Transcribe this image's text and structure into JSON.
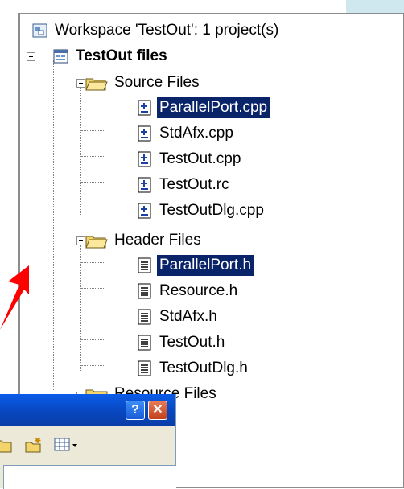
{
  "tree": {
    "workspace_label": "Workspace 'TestOut': 1 project(s)",
    "project_label": "TestOut files",
    "folders": [
      {
        "label": "Source Files",
        "items": [
          "ParallelPort.cpp",
          "StdAfx.cpp",
          "TestOut.cpp",
          "TestOut.rc",
          "TestOutDlg.cpp"
        ],
        "selected_index": 0
      },
      {
        "label": "Header Files",
        "items": [
          "ParallelPort.h",
          "Resource.h",
          "StdAfx.h",
          "TestOut.h",
          "TestOutDlg.h"
        ],
        "selected_index": 0
      },
      {
        "label": "Resource Files",
        "items": []
      }
    ]
  },
  "dialog": {
    "help_icon": "?",
    "close_icon": "✕"
  },
  "colors": {
    "selection_bg": "#0a246a",
    "selection_fg": "#ffffff",
    "arrow": "#ff0000",
    "titlebar": "#0a5ce8"
  },
  "icons": {
    "workspace": "workspace-icon",
    "project": "project-icon",
    "folder": "folder-icon",
    "cpp_file": "source-file-icon",
    "header_file": "header-file-icon"
  }
}
